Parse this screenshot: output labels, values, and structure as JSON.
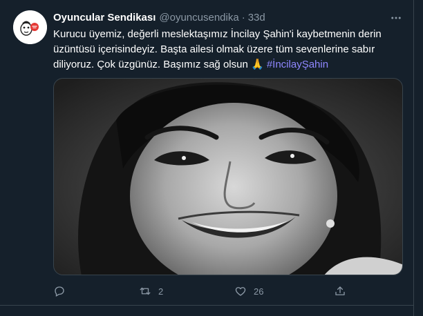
{
  "tweet": {
    "author_name": "Oyuncular Sendikası",
    "author_handle": "@oyuncusendika",
    "separator": "·",
    "time": "33d",
    "more_icon": "more-icon",
    "text_part": "Kurucu üyemiz, değerli meslektaşımız İncilay Şahin'i kaybetmenin derin üzüntüsü içerisindeyiz. Başta ailesi olmak üzere tüm sevenlerine sabır diliyoruz. Çok üzgünüz. Başımız sağ olsun 🙏",
    "hashtag": "#İncilayŞahin"
  },
  "actions": {
    "reply_count": "",
    "retweet_count": "2",
    "like_count": "26",
    "share_icon": "share-icon"
  },
  "colors": {
    "background": "#15202b",
    "secondary_text": "#8b98a5",
    "hashtag": "#8f87ff",
    "border": "#38444d"
  }
}
